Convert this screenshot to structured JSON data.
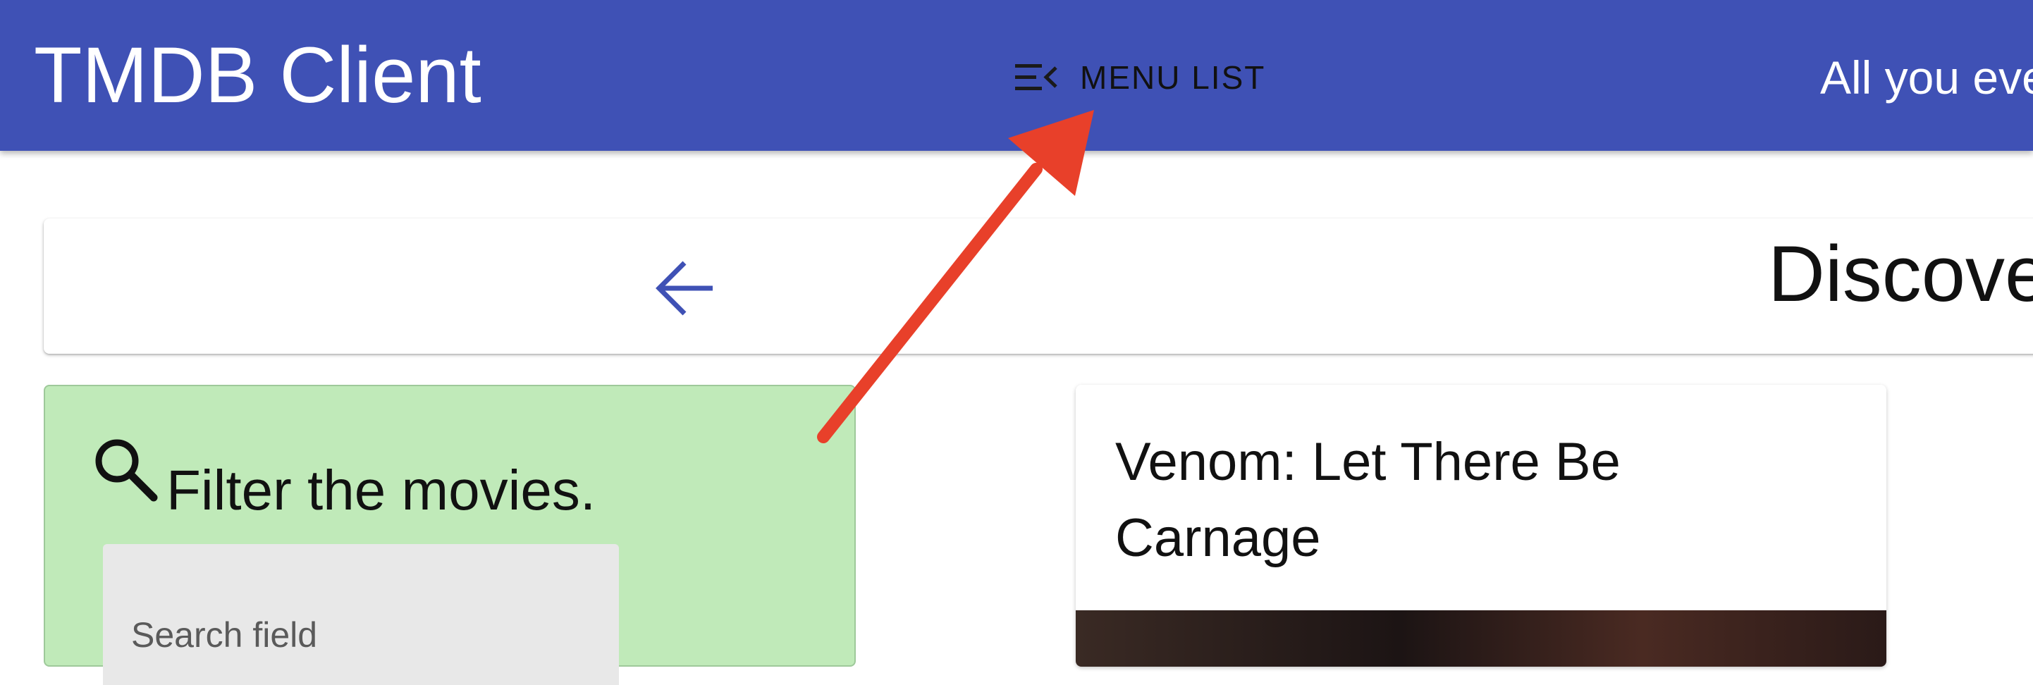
{
  "app": {
    "title": "TMDB Client",
    "tagline": "All you eve"
  },
  "menu": {
    "label": "MENU LIST",
    "icon": "menu-open-icon"
  },
  "page": {
    "title": "Discove",
    "back_icon": "arrow-back-icon"
  },
  "filter": {
    "title": "Filter the movies.",
    "icon": "search-icon",
    "search_placeholder": "Search field"
  },
  "movies": [
    {
      "title": "Venom: Let There Be Carnage"
    }
  ],
  "annotation": {
    "type": "arrow",
    "color": "#e8402a",
    "target": "menu-list-button"
  },
  "colors": {
    "appbar": "#3f51b5",
    "filter_card": "#c0eab9",
    "accent_icon": "#3f51b5"
  }
}
